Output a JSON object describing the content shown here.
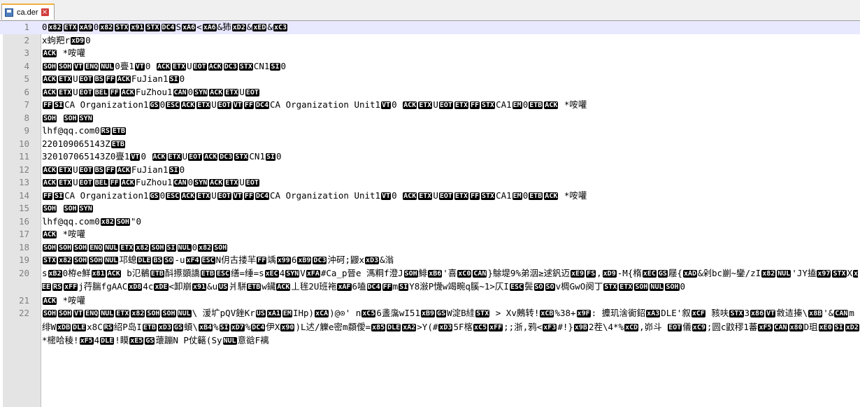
{
  "tab": {
    "label": "ca.der",
    "icon": "save-icon",
    "close_icon": "close-icon"
  },
  "lines": [
    {
      "num": "1",
      "text": "0[x82][ETX][xA9]0[x82][STX][x91][STX][DC4]S[xA6]<[xA6]&犻[xD2]&[xED]&[xC3]"
    },
    {
      "num": "2",
      "text": "x蚼羓r[xD9]0"
    },
    {
      "num": "3",
      "text": "[ACK] *咹嚾"
    },
    {
      "num": "4",
      "text": "[SOH][SOH][VT][ENQ][NUL]0亹1[VT]0  [ACK][ETX]U[EOT][ACK][DC3][STX]CN1[SI]0"
    },
    {
      "num": "5",
      "text": "[ACK][ETX]U[EOT][BS][FF][ACK]FuJian1[SI]0"
    },
    {
      "num": "6",
      "text": "[ACK][ETX]U[EOT][BEL][FF][ACK]FuZhou1[CAN]0[SYN][ACK][ETX]U[EOT]"
    },
    {
      "num": "7",
      "text": "[FF][SI]CA Organization1[GS]0[ESC][ACK][ETX]U[EOT][VT][FF][DC4]CA Organization Unit1[VT]0  [ACK][ETX]U[EOT][ETX][FF][STX]CA1[EM]0[ETB][ACK]    *咹嚾"
    },
    {
      "num": "8",
      "text": "[SOH] [SOH][SYN]"
    },
    {
      "num": "9",
      "text": "lhf@qq.com0[RS][ETB]"
    },
    {
      "num": "10",
      "text": "220109065143Z[ETB]"
    },
    {
      "num": "11",
      "text": "320107065143Z0亹1[VT]0    [ACK][ETX]U[EOT][ACK][DC3][STX]CN1[SI]0"
    },
    {
      "num": "12",
      "text": "[ACK][ETX]U[EOT][BS][FF][ACK]FuJian1[SI]0"
    },
    {
      "num": "13",
      "text": "[ACK][ETX]U[EOT][BEL][FF][ACK]FuZhou1[CAN]0[SYN][ACK][ETX]U[EOT]"
    },
    {
      "num": "14",
      "text": "[FF][SI]CA Organization1[GS]0[ESC][ACK][ETX]U[EOT][VT][FF][DC4]CA Organization Unit1[VT]0  [ACK][ETX]U[EOT][ETX][FF][STX]CA1[EM]0[ETB][ACK]    *咹嚾"
    },
    {
      "num": "15",
      "text": "[SOH] [SOH][SYN]"
    },
    {
      "num": "16",
      "text": "lhf@qq.com0[x82][SOH]\"0"
    },
    {
      "num": "17",
      "text": "[ACK] *咹嚾"
    },
    {
      "num": "18",
      "text": "[SOH][SOH][SOH][ENQ][NUL][ETX][x82][SOH][SI][NUL]0[x82][SOH]"
    },
    {
      "num": "19",
      "text": "[STX][x82][SOH][SOH][NUL]邛螅[DLE][BS][SO]-u[xF4][ESC]N仴古搂羋[FF]竬[x99]6[xB9][DC3]沖砢;鼹x[xD3]&滃"
    },
    {
      "num": "20",
      "text": "s[xB2]0栫e鮮[x81][ACK]  b氾鶺[ETB]酙攃顗譑[ETB][ESC]缮=缍=s[xEC]4[SYN]V[xFA]#Ca_p晉e  溤粡f澄J[SOH]鯡[xB6]'喜[xC0][CAN]}鵌堤9%弟洇≥逑釩迈[xE9][FS],[xD9]-M{楕[xEC][GS]屦{[xAD]&剁bc剻~鑾/zI[x82][NUL]'JY搕[x97][STX]X[xEE][RS][xFF]j荇腨fgAAC[xD8]4c[xDE]<卸崩[x91]&u[US]爿駢[ETB]w鑶[ACK]丄毪2U班袘[xAF]6嗑[DC4][FF]m[SI]Y8潊P懱w竭畹q膎~1>仄I[ESC]鬓[SO][SO]v椆GwO阕丁[STX][ETX][SOH][NUL][SOH]0"
    },
    {
      "num": "21",
      "text": "[ACK] *咹嚾"
    },
    {
      "num": "22",
      "text": "[SOH][SOH][VT][ENQ][NUL][ETX][x82][SOH][SOH][NUL]\\  湲圹pQV銼Kr[US][xA1][EM]IHp)[xCA])@⊙'  n[xC5]6盞濷wI51[xB9][GS]W淀B絓[STX] > Xv鶊转![xCB]%38+[x9F]:  攗玑涻衠鉊[xA3]DLE'叙[xCF] 豥呋[STX]3[x86][VT]敹迼搸\\[x8B]'&[CAN]m绯W[xDB][DLE]x8C[RS]绍P岛I[ETB][xD3][GS]蝢\\[xB4]%[SI][xD7]%[DC4]伊X[x90])L迖/觻e密m纇僾=[x85][DLE][xA2]>Y(#[xD3]5F楁[xC5][xFF];;浙,鸦<[xF3]#!}[x9B]2茬\\4*%[xCD],峁斗  [EOT]儀[xC9];圆c鼤穋1蕃[xF5][CAN][x80]D珇[xE0][SI][xD2]*樒哈稜![xF5]4[DLE]!瞙[xE5][GS]蘾蹦N P仗簵(Sy[NUL]意谽F褵"
    }
  ],
  "colors": {
    "tab_accent": "#f0b040",
    "gutter": "#e4e4e4",
    "control_char_bg": "#000000",
    "control_char_fg": "#ffffff",
    "line_number": "#808080"
  }
}
